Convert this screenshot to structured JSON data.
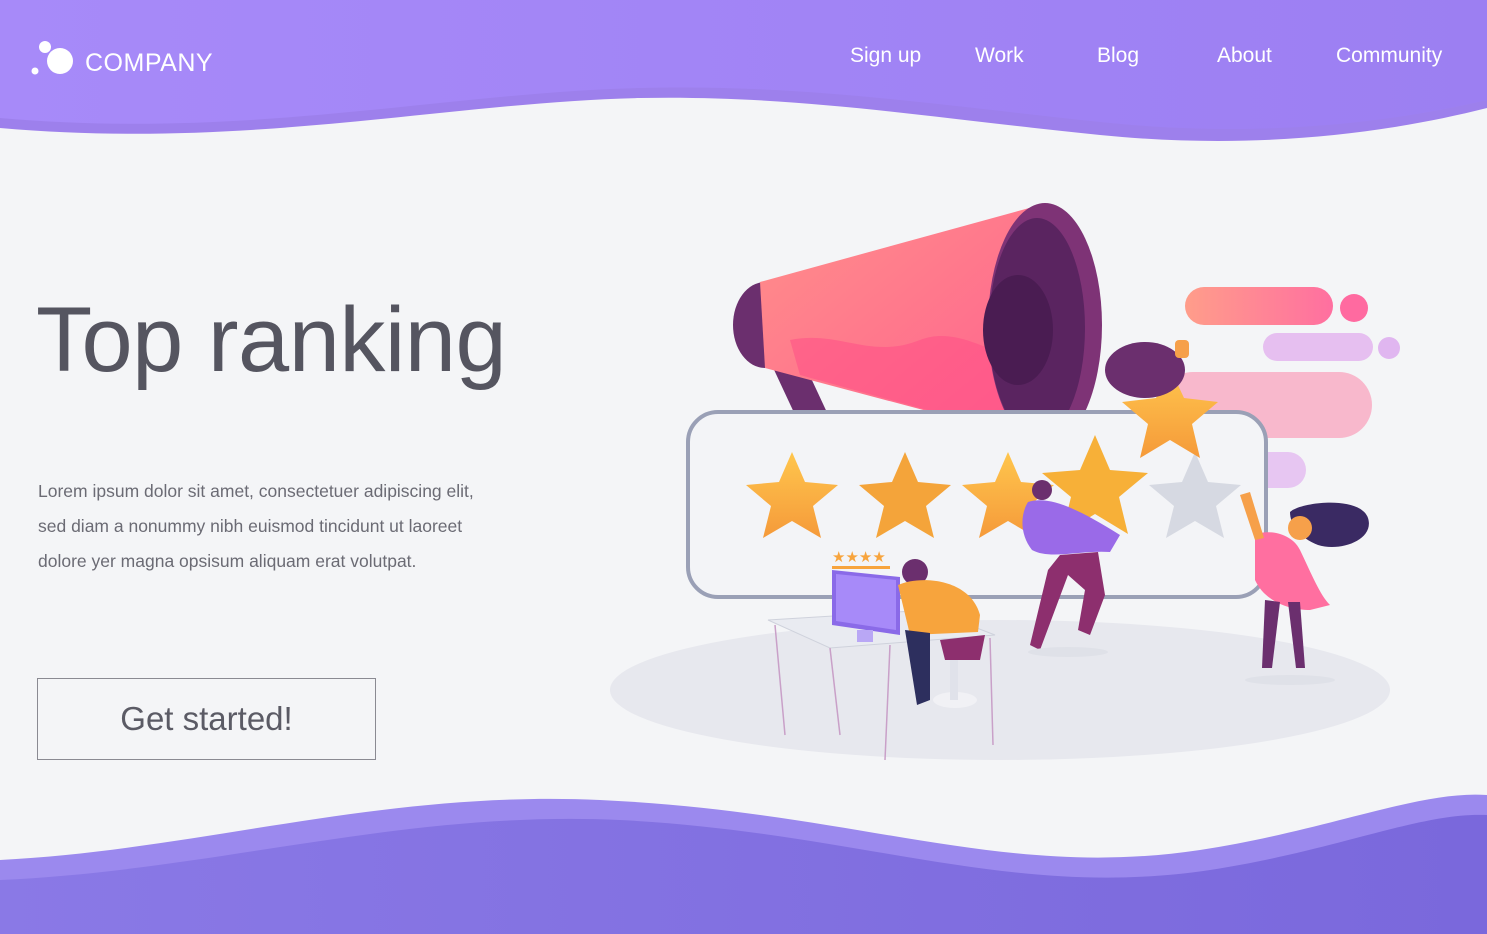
{
  "header": {
    "brand": "COMPANY",
    "nav": [
      {
        "label": "Sign up"
      },
      {
        "label": "Work"
      },
      {
        "label": "Blog"
      },
      {
        "label": "About"
      },
      {
        "label": "Community"
      }
    ]
  },
  "hero": {
    "title": "Top ranking",
    "body_lines": [
      "Lorem ipsum dolor sit amet, consectetuer adipiscing elit,",
      "sed diam a  nonummy nibh euismod tincidunt ut laoreet",
      "dolore yer magna opsisum aliquam erat volutpat."
    ],
    "cta_label": "Get started!"
  },
  "illustration": {
    "rating_filled": 4,
    "rating_total": 5,
    "icons": [
      "megaphone-icon",
      "star-icon",
      "computer-monitor-icon"
    ]
  },
  "colors": {
    "brand_purple": "#9b7ef0",
    "wave_light": "#a98af8",
    "wave_bottom": "#7e6ee0",
    "star_gold": "#f7b744",
    "megaphone_pink": "#ff7a96",
    "megaphone_plum": "#6b2f6e"
  }
}
